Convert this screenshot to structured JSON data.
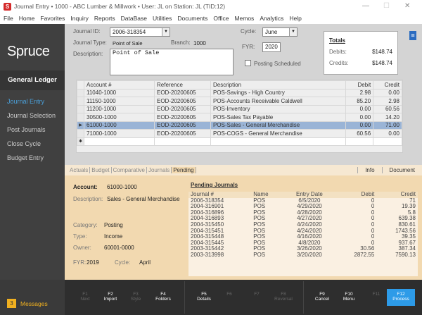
{
  "window": {
    "app_icon": "S",
    "title": "Journal Entry  •  1000 - ABC Lumber & Millwork  •  User: JL on Station: JL (TID:12)"
  },
  "menu": [
    "File",
    "Home",
    "Favorites",
    "Inquiry",
    "Reports",
    "DataBase",
    "Utilities",
    "Documents",
    "Office",
    "Memos",
    "Analytics",
    "Help"
  ],
  "sidebar": {
    "brand": "Spruce",
    "section": "General Ledger",
    "items": [
      "Journal Entry",
      "Journal Selection",
      "Post Journals",
      "Close Cycle",
      "Budget Entry"
    ],
    "messages_count": "3",
    "messages_label": "Messages"
  },
  "form": {
    "journal_id_label": "Journal ID:",
    "journal_id": "2006-318354",
    "journal_type_label": "Journal Type:",
    "journal_type": "Point of Sale",
    "branch_label": "Branch:",
    "branch": "1000",
    "description_label": "Description:",
    "description": "Point of Sale",
    "cycle_label": "Cycle:",
    "cycle": "June",
    "fyr_label": "FYR:",
    "fyr": "2020",
    "posting_scheduled": "Posting Scheduled"
  },
  "totals": {
    "title": "Totals",
    "debits_label": "Debits:",
    "debits": "$148.74",
    "credits_label": "Credits:",
    "credits": "$148.74"
  },
  "grid": {
    "headers": [
      "Account #",
      "Reference",
      "Description",
      "Debit",
      "Credit"
    ],
    "rows": [
      [
        "11040-1000",
        "EOD-20200605",
        "POS-Savings - High Country",
        "2.98",
        "0.00"
      ],
      [
        "11150-1000",
        "EOD-20200605",
        "POS-Accounts Receivable Caldwell",
        "85.20",
        "2.98"
      ],
      [
        "11200-1000",
        "EOD-20200605",
        "POS-Inventory",
        "0.00",
        "60.56"
      ],
      [
        "30500-1000",
        "EOD-20200605",
        "POS-Sales Tax Payable",
        "0.00",
        "14.20"
      ],
      [
        "61000-1000",
        "EOD-20200605",
        "POS-Sales - General Merchandise",
        "0.00",
        "71.00"
      ],
      [
        "71000-1000",
        "EOD-20200605",
        "POS-COGS - General Merchandise",
        "60.56",
        "0.00"
      ]
    ]
  },
  "tabs": {
    "items": [
      "Actuals",
      "Budget",
      "Comparative",
      "Journals",
      "Pending"
    ],
    "right": [
      "Info",
      "Document"
    ]
  },
  "account": {
    "account_label": "Account:",
    "account": "61000-1000",
    "description_label": "Description:",
    "description": "Sales - General Merchandise",
    "category_label": "Category:",
    "category": "Posting",
    "type_label": "Type:",
    "type": "Income",
    "owner_label": "Owner:",
    "owner": "60001-0000",
    "fyr_label": "FYR:",
    "fyr": "2019",
    "cycle_label": "Cycle:",
    "cycle": "April"
  },
  "pending": {
    "title": "Pending Journals",
    "headers": [
      "Journal #",
      "Name",
      "Entry Date",
      "Debit",
      "Credit"
    ],
    "rows": [
      [
        "2006-318354",
        "POS",
        "6/5/2020",
        "0",
        "71"
      ],
      [
        "2004-316901",
        "POS",
        "4/29/2020",
        "0",
        "19.39"
      ],
      [
        "2004-316896",
        "POS",
        "4/28/2020",
        "0",
        "5.8"
      ],
      [
        "2004-316893",
        "POS",
        "4/27/2020",
        "0",
        "639.38"
      ],
      [
        "2004-315450",
        "POS",
        "4/24/2020",
        "0",
        "830.61"
      ],
      [
        "2004-315451",
        "POS",
        "4/24/2020",
        "0",
        "1743.56"
      ],
      [
        "2004-315448",
        "POS",
        "4/16/2020",
        "0",
        "39.35"
      ],
      [
        "2004-315445",
        "POS",
        "4/8/2020",
        "0",
        "937.67"
      ],
      [
        "2003-315442",
        "POS",
        "3/26/2020",
        "30.56",
        "387.34"
      ],
      [
        "2003-313998",
        "POS",
        "3/20/2020",
        "2872.55",
        "7590.13"
      ]
    ]
  },
  "fkeys": [
    {
      "key": "F1",
      "label": "Next",
      "enabled": false
    },
    {
      "key": "F2",
      "label": "Import",
      "enabled": true
    },
    {
      "key": "F3",
      "label": "Style",
      "enabled": false
    },
    {
      "key": "F4",
      "label": "Folders",
      "enabled": true
    },
    {
      "key": "F5",
      "label": "Details",
      "enabled": true
    },
    {
      "key": "F6",
      "label": "",
      "enabled": false
    },
    {
      "key": "F7",
      "label": "",
      "enabled": false
    },
    {
      "key": "F8",
      "label": "Reversal",
      "enabled": false
    },
    {
      "key": "F9",
      "label": "Cancel",
      "enabled": true
    },
    {
      "key": "F10",
      "label": "Menu",
      "enabled": true
    },
    {
      "key": "F11",
      "label": "",
      "enabled": false
    },
    {
      "key": "F12",
      "label": "Process",
      "enabled": true
    }
  ]
}
